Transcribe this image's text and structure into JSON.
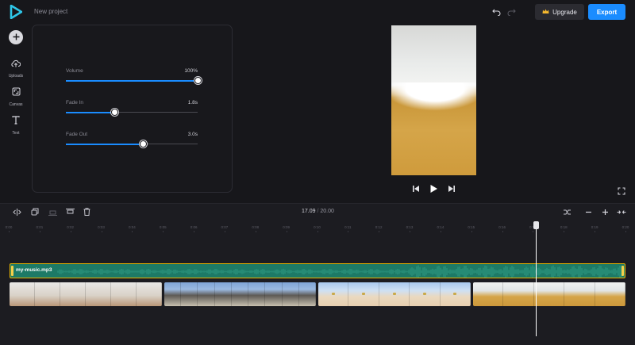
{
  "header": {
    "project_title": "New project",
    "upgrade_label": "Upgrade",
    "export_label": "Export"
  },
  "rail": {
    "items": [
      {
        "label": "Uploads",
        "icon": "upload-icon"
      },
      {
        "label": "Canvas",
        "icon": "resize-icon"
      },
      {
        "label": "Text",
        "icon": "text-icon"
      }
    ]
  },
  "audio_panel": {
    "volume": {
      "label": "Volume",
      "value": "100%",
      "level": 1.0
    },
    "fade_in": {
      "label": "Fade In",
      "value": "1.8s",
      "level": 0.37
    },
    "fade_out": {
      "label": "Fade Out",
      "value": "3.0s",
      "level": 0.59
    }
  },
  "timeline": {
    "current_time": "17.09",
    "separator": "/",
    "total_time": "20.00",
    "ruler_ticks": [
      "0:00",
      "0:01",
      "0:02",
      "0:03",
      "0:04",
      "0:05",
      "0:06",
      "0:07",
      "0:08",
      "0:09",
      "0:10",
      "0:11",
      "0:12",
      "0:13",
      "0:14",
      "0:15",
      "0:16",
      "0:17",
      "0:18",
      "0:19",
      "0:20"
    ],
    "audio_clip_name": "my-music.mp3"
  },
  "colors": {
    "accent": "#1a8cff",
    "audio_track": "#1d7a66",
    "audio_border": "#e8b400"
  }
}
